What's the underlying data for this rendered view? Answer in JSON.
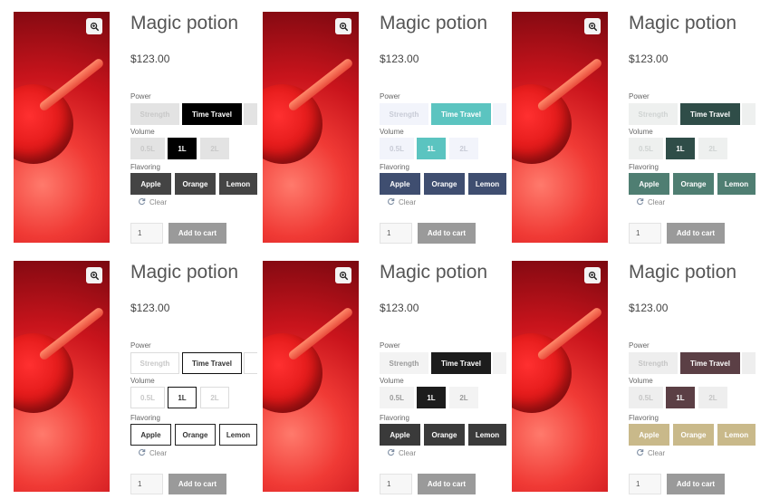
{
  "product": {
    "title": "Magic potion",
    "price": "$123.00",
    "power_label": "Power",
    "volume_label": "Volume",
    "flavoring_label": "Flavoring",
    "power_options": [
      "Strength",
      "Time Travel"
    ],
    "volume_options": [
      "0.5L",
      "1L",
      "2L"
    ],
    "flavor_options": [
      "Apple",
      "Orange",
      "Lemon"
    ],
    "selected_power": "Time Travel",
    "selected_volume": "1L",
    "clear_label": "Clear",
    "quantity": "1",
    "add_to_cart_label": "Add to cart"
  },
  "icons": {
    "zoom": "zoom-in-icon",
    "clear": "refresh-icon"
  },
  "variants": [
    {
      "style": "filled",
      "accent": "#000000",
      "accent_text": "#ffffff",
      "muted_bg": "#e3e3e3",
      "muted_text": "#c8c8c8",
      "flavor_bg": "#444444",
      "flavor_text": "#ffffff"
    },
    {
      "style": "filled",
      "accent": "#5bc4c0",
      "accent_text": "#ffffff",
      "muted_bg": "#f2f4fb",
      "muted_text": "#c8cbd6",
      "flavor_bg": "#3f4e70",
      "flavor_text": "#ffffff"
    },
    {
      "style": "filled",
      "accent": "#2f4d48",
      "accent_text": "#ffffff",
      "muted_bg": "#eef0ef",
      "muted_text": "#cfd3d2",
      "flavor_bg": "#4f7e72",
      "flavor_text": "#ffffff"
    },
    {
      "style": "outlined",
      "accent": "#000000",
      "accent_text": "#333333",
      "muted_bg": "#ffffff",
      "muted_text": "#c8c8c8",
      "flavor_bg": "#ffffff",
      "flavor_text": "#333333"
    },
    {
      "style": "filled",
      "accent": "#1c1c1c",
      "accent_text": "#ffffff",
      "muted_bg": "#f3f3f3",
      "muted_text": "#9a9a9a",
      "flavor_bg": "#3a3a3a",
      "flavor_text": "#ffffff"
    },
    {
      "style": "filled",
      "accent": "#5b3f45",
      "accent_text": "#ffffff",
      "muted_bg": "#eeeeee",
      "muted_text": "#c5c5c5",
      "flavor_bg": "#c9b98a",
      "flavor_text": "#ffffff"
    }
  ]
}
